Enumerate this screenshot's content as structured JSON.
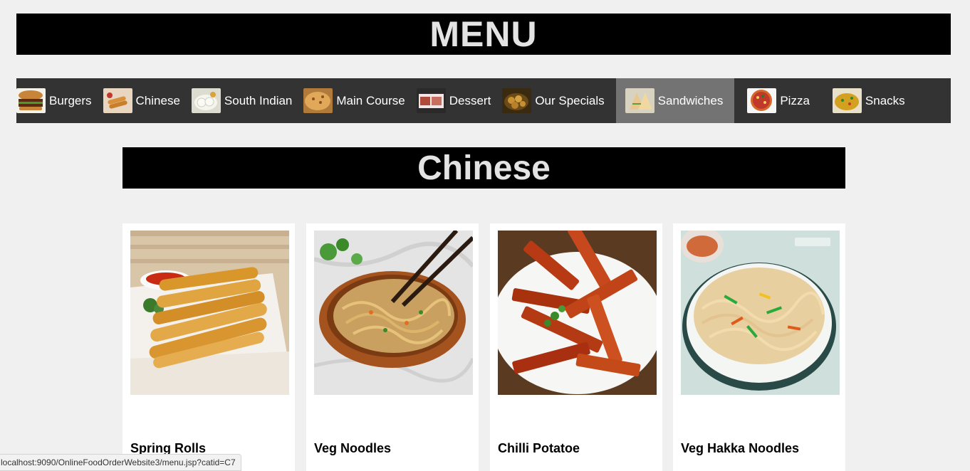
{
  "header": {
    "title": "MENU"
  },
  "nav": {
    "items": [
      {
        "label": "Burgers",
        "icon": "burger-icon",
        "thumb_color": "#8b3a1e",
        "active": false
      },
      {
        "label": "Chinese",
        "icon": "chinese-icon",
        "thumb_color": "#d9a066",
        "active": false
      },
      {
        "label": "South Indian",
        "icon": "south-indian-icon",
        "thumb_color": "#c9c4a8",
        "active": false
      },
      {
        "label": "Main Course",
        "icon": "main-course-icon",
        "thumb_color": "#c4853a",
        "active": false
      },
      {
        "label": "Dessert",
        "icon": "dessert-icon",
        "thumb_color": "#a04a3a",
        "active": false
      },
      {
        "label": "Our Specials",
        "icon": "specials-icon",
        "thumb_color": "#8a6a20",
        "active": false
      },
      {
        "label": "Sandwiches",
        "icon": "sandwich-icon",
        "thumb_color": "#b0a890",
        "active": true
      },
      {
        "label": "Pizza",
        "icon": "pizza-icon",
        "thumb_color": "#c0392b",
        "active": false
      },
      {
        "label": "Snacks",
        "icon": "snacks-icon",
        "thumb_color": "#d4a020",
        "active": false
      }
    ]
  },
  "category": {
    "title": "Chinese"
  },
  "products": [
    {
      "name": "Spring Rolls",
      "icon": "spring-rolls-photo"
    },
    {
      "name": "Veg Noodles",
      "icon": "veg-noodles-photo"
    },
    {
      "name": "Chilli Potatoe",
      "icon": "chilli-potato-photo"
    },
    {
      "name": "Veg Hakka Noodles",
      "icon": "hakka-noodles-photo"
    }
  ],
  "status_bar": {
    "url": "localhost:9090/OnlineFoodOrderWebsite3/menu.jsp?catid=C7"
  },
  "colors": {
    "banner_bg": "#000000",
    "banner_text": "#e3e3e3",
    "nav_bg": "#333333",
    "nav_active": "#737373",
    "page_bg": "#f0f0f0"
  }
}
